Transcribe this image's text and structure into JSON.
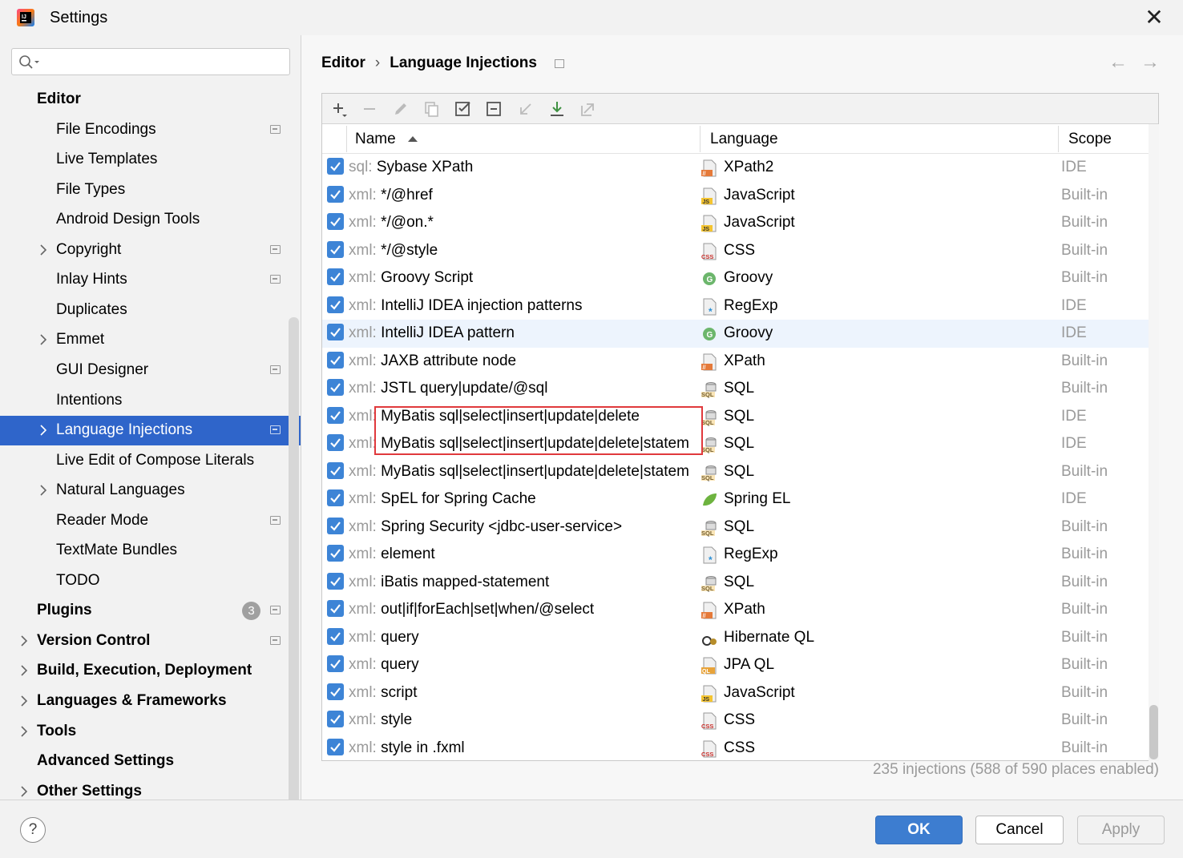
{
  "window": {
    "title": "Settings"
  },
  "search": {
    "placeholder": ""
  },
  "sidebar": {
    "items": [
      {
        "label": "Editor",
        "level": 0,
        "bold": true,
        "chevron": false,
        "proj": false
      },
      {
        "label": "File Encodings",
        "level": 1,
        "bold": false,
        "chevron": false,
        "proj": true
      },
      {
        "label": "Live Templates",
        "level": 1,
        "bold": false,
        "chevron": false,
        "proj": false
      },
      {
        "label": "File Types",
        "level": 1,
        "bold": false,
        "chevron": false,
        "proj": false
      },
      {
        "label": "Android Design Tools",
        "level": 1,
        "bold": false,
        "chevron": false,
        "proj": false
      },
      {
        "label": "Copyright",
        "level": 1,
        "bold": false,
        "chevron": true,
        "proj": true
      },
      {
        "label": "Inlay Hints",
        "level": 1,
        "bold": false,
        "chevron": false,
        "proj": true
      },
      {
        "label": "Duplicates",
        "level": 1,
        "bold": false,
        "chevron": false,
        "proj": false
      },
      {
        "label": "Emmet",
        "level": 1,
        "bold": false,
        "chevron": true,
        "proj": false
      },
      {
        "label": "GUI Designer",
        "level": 1,
        "bold": false,
        "chevron": false,
        "proj": true
      },
      {
        "label": "Intentions",
        "level": 1,
        "bold": false,
        "chevron": false,
        "proj": false
      },
      {
        "label": "Language Injections",
        "level": 1,
        "bold": false,
        "chevron": true,
        "proj": true,
        "selected": true
      },
      {
        "label": "Live Edit of Compose Literals",
        "level": 1,
        "bold": false,
        "chevron": false,
        "proj": false
      },
      {
        "label": "Natural Languages",
        "level": 1,
        "bold": false,
        "chevron": true,
        "proj": false
      },
      {
        "label": "Reader Mode",
        "level": 1,
        "bold": false,
        "chevron": false,
        "proj": true
      },
      {
        "label": "TextMate Bundles",
        "level": 1,
        "bold": false,
        "chevron": false,
        "proj": false
      },
      {
        "label": "TODO",
        "level": 1,
        "bold": false,
        "chevron": false,
        "proj": false
      },
      {
        "label": "Plugins",
        "level": 0,
        "bold": true,
        "chevron": false,
        "proj": true,
        "badge": "3"
      },
      {
        "label": "Version Control",
        "level": 0,
        "bold": true,
        "chevron": true,
        "proj": true
      },
      {
        "label": "Build, Execution, Deployment",
        "level": 0,
        "bold": true,
        "chevron": true,
        "proj": false
      },
      {
        "label": "Languages & Frameworks",
        "level": 0,
        "bold": true,
        "chevron": true,
        "proj": false
      },
      {
        "label": "Tools",
        "level": 0,
        "bold": true,
        "chevron": true,
        "proj": false
      },
      {
        "label": "Advanced Settings",
        "level": 0,
        "bold": true,
        "chevron": false,
        "proj": false
      },
      {
        "label": "Other Settings",
        "level": 0,
        "bold": true,
        "chevron": true,
        "proj": false
      }
    ]
  },
  "breadcrumb": {
    "parent": "Editor",
    "current": "Language Injections",
    "separator": "›"
  },
  "nav": {
    "back": "←",
    "forward": "→"
  },
  "table": {
    "headers": {
      "name": "Name",
      "language": "Language",
      "scope": "Scope"
    },
    "rows": [
      {
        "prefix": "sql:",
        "name": "Sybase XPath",
        "lang": "XPath2",
        "icon": "xpath-icon",
        "scope": "IDE"
      },
      {
        "prefix": "xml:",
        "name": "*/@href",
        "lang": "JavaScript",
        "icon": "javascript-icon",
        "scope": "Built-in"
      },
      {
        "prefix": "xml:",
        "name": "*/@on.*",
        "lang": "JavaScript",
        "icon": "javascript-icon",
        "scope": "Built-in"
      },
      {
        "prefix": "xml:",
        "name": "*/@style",
        "lang": "CSS",
        "icon": "css-icon",
        "scope": "Built-in"
      },
      {
        "prefix": "xml:",
        "name": "Groovy Script",
        "lang": "Groovy",
        "icon": "groovy-icon",
        "scope": "Built-in"
      },
      {
        "prefix": "xml:",
        "name": "IntelliJ IDEA injection patterns",
        "lang": "RegExp",
        "icon": "regexp-icon",
        "scope": "IDE"
      },
      {
        "prefix": "xml:",
        "name": "IntelliJ IDEA pattern",
        "lang": "Groovy",
        "icon": "groovy-icon",
        "scope": "IDE",
        "highlight": true
      },
      {
        "prefix": "xml:",
        "name": "JAXB attribute node",
        "lang": "XPath",
        "icon": "xpath-icon",
        "scope": "Built-in"
      },
      {
        "prefix": "xml:",
        "name": "JSTL query|update/@sql",
        "lang": "SQL",
        "icon": "sql-icon",
        "scope": "Built-in"
      },
      {
        "prefix": "xml:",
        "name": "MyBatis sql|select|insert|update|delete",
        "lang": "SQL",
        "icon": "sql-icon",
        "scope": "IDE"
      },
      {
        "prefix": "xml:",
        "name": "MyBatis sql|select|insert|update|delete|statem",
        "lang": "SQL",
        "icon": "sql-icon",
        "scope": "IDE"
      },
      {
        "prefix": "xml:",
        "name": "MyBatis sql|select|insert|update|delete|statem",
        "lang": "SQL",
        "icon": "sql-icon",
        "scope": "Built-in"
      },
      {
        "prefix": "xml:",
        "name": "SpEL for Spring Cache",
        "lang": "Spring EL",
        "icon": "spring-icon",
        "scope": "IDE"
      },
      {
        "prefix": "xml:",
        "name": "Spring Security <jdbc-user-service>",
        "lang": "SQL",
        "icon": "sql-icon",
        "scope": "Built-in"
      },
      {
        "prefix": "xml:",
        "name": "element",
        "lang": "RegExp",
        "icon": "regexp-icon",
        "scope": "Built-in"
      },
      {
        "prefix": "xml:",
        "name": "iBatis mapped-statement",
        "lang": "SQL",
        "icon": "sql-icon",
        "scope": "Built-in"
      },
      {
        "prefix": "xml:",
        "name": "out|if|forEach|set|when/@select",
        "lang": "XPath",
        "icon": "xpath-icon",
        "scope": "Built-in"
      },
      {
        "prefix": "xml:",
        "name": "query",
        "lang": "Hibernate QL",
        "icon": "hibernate-icon",
        "scope": "Built-in"
      },
      {
        "prefix": "xml:",
        "name": "query",
        "lang": "JPA QL",
        "icon": "jpa-icon",
        "scope": "Built-in"
      },
      {
        "prefix": "xml:",
        "name": "script",
        "lang": "JavaScript",
        "icon": "javascript-icon",
        "scope": "Built-in"
      },
      {
        "prefix": "xml:",
        "name": "style",
        "lang": "CSS",
        "icon": "css-icon",
        "scope": "Built-in"
      },
      {
        "prefix": "xml:",
        "name": "style in .fxml",
        "lang": "CSS",
        "icon": "css-icon",
        "scope": "Built-in"
      }
    ]
  },
  "status": "235 injections (588 of 590 places enabled)",
  "footer": {
    "help": "?",
    "ok": "OK",
    "cancel": "Cancel",
    "apply": "Apply"
  },
  "colors": {
    "accent": "#2f65ca",
    "checkbox": "#3d84d6",
    "highlight_box": "#e0393c"
  }
}
